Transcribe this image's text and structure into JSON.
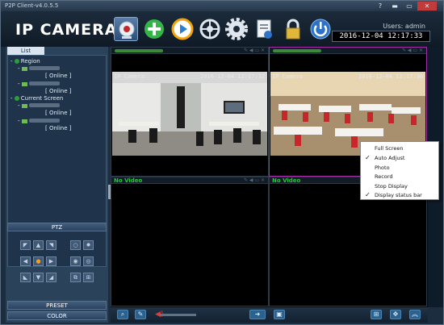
{
  "window": {
    "title": "P2P Client-v4.0.5.5",
    "help": "?",
    "minimize": "▬",
    "maximize": "▭",
    "close": "✕"
  },
  "header": {
    "logo": "IP CAMERA",
    "users_label": "Users: admin",
    "clock": "2016-12-04 12:17:33"
  },
  "toolbar": [
    {
      "name": "monitor",
      "icon": "camera-monitor-icon",
      "selected": true
    },
    {
      "name": "add",
      "icon": "add-device-icon"
    },
    {
      "name": "playback",
      "icon": "playback-icon"
    },
    {
      "name": "ptz-wheel",
      "icon": "ptz-wheel-icon"
    },
    {
      "name": "settings",
      "icon": "gear-icon"
    },
    {
      "name": "log",
      "icon": "log-icon"
    },
    {
      "name": "lock",
      "icon": "lock-icon"
    },
    {
      "name": "power",
      "icon": "power-icon"
    }
  ],
  "sidebar": {
    "tab": "List",
    "tree": [
      {
        "label": "Region",
        "indent": 0,
        "kind": "group"
      },
      {
        "label": "",
        "indent": 1,
        "kind": "camera"
      },
      {
        "label": "[  Online  ]",
        "indent": 2,
        "kind": "status"
      },
      {
        "label": "",
        "indent": 1,
        "kind": "camera"
      },
      {
        "label": "[  Online  ]",
        "indent": 2,
        "kind": "status"
      },
      {
        "label": "Current Screen",
        "indent": 0,
        "kind": "group"
      },
      {
        "label": "",
        "indent": 1,
        "kind": "camera"
      },
      {
        "label": "[  Online  ]",
        "indent": 2,
        "kind": "status"
      },
      {
        "label": "",
        "indent": 1,
        "kind": "camera"
      },
      {
        "label": "[  Online  ]",
        "indent": 2,
        "kind": "status"
      }
    ],
    "ptz_label": "PTZ",
    "preset_label": "PRESET",
    "color_label": "COLOR"
  },
  "grid": {
    "cells": [
      {
        "header": "",
        "camera_label": "IP Camera",
        "timestamp": "2016-12-04 12:17:32",
        "has_video": true,
        "active": false
      },
      {
        "header": "",
        "camera_label": "IP Camera",
        "timestamp": "2016-12-04 12:17:30",
        "has_video": true,
        "active": true
      },
      {
        "header": "No Video",
        "camera_label": "",
        "timestamp": "",
        "has_video": false,
        "active": false
      },
      {
        "header": "No Video",
        "camera_label": "",
        "timestamp": "",
        "has_video": false,
        "active": false
      }
    ]
  },
  "context_menu": [
    {
      "label": "Full Screen",
      "checked": false
    },
    {
      "label": "Auto Adjust",
      "checked": true
    },
    {
      "label": "Photo",
      "checked": false
    },
    {
      "label": "Record",
      "checked": false
    },
    {
      "label": "Stop Display",
      "checked": false
    },
    {
      "label": "Display status bar",
      "checked": true
    }
  ],
  "colors": {
    "accent": "#2b4e78",
    "active_border": "#a22da4",
    "online_text": "#e6eef5",
    "no_video": "#22c93a"
  }
}
